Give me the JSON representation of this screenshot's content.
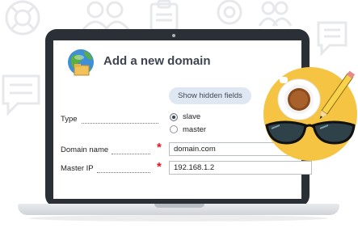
{
  "form": {
    "title": "Add a new domain",
    "show_hidden_label": "Show hidden fields",
    "type_label": "Type",
    "type_options": [
      "slave",
      "master"
    ],
    "type_selected": "slave",
    "domain_label": "Domain name",
    "domain_value": "domain.com",
    "ip_label": "Master IP",
    "ip_value": "192.168.1.2",
    "required_mark": "*"
  },
  "icons": [
    "lifebuoy-icon",
    "users-icon",
    "clipboard-icon",
    "lifebuoy-icon",
    "users-icon",
    "chat-bubble-icon",
    "chat-bubble-icon",
    "globe-icon",
    "coffee-cup-icon",
    "pencil-icon",
    "glasses-icon"
  ],
  "colors": {
    "laptop": "#2b2f36",
    "accent_yellow": "#f6c443",
    "required": "#e3141b",
    "button_bg": "#dfe7f2"
  }
}
